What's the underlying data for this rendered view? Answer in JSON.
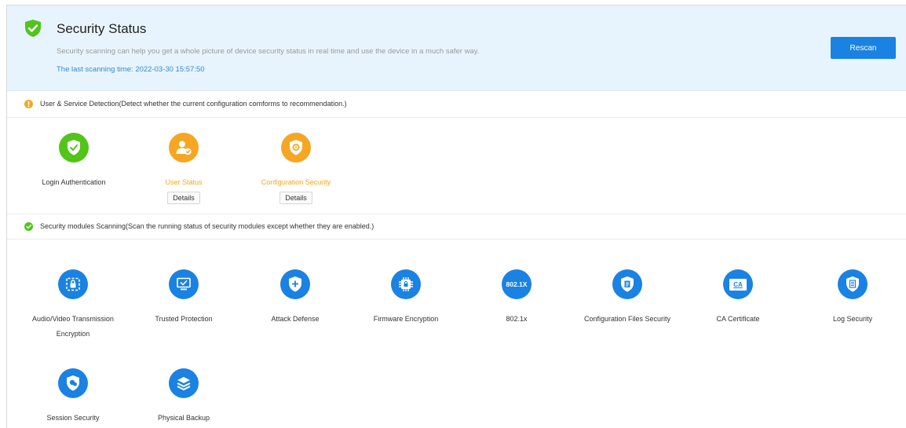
{
  "header": {
    "title": "Security Status",
    "description": "Security scanning can help you get a whole picture of device security status in real time and use the device in a much safer way.",
    "last_scan": "The last scanning time: 2022-03-30 15:57:50",
    "rescan_label": "Rescan"
  },
  "user_service": {
    "status": "warning",
    "heading": "User & Service Detection(Detect whether the current configuration comforms to recommendation.)",
    "items": [
      {
        "label": "Login Authentication",
        "state": "ok",
        "icon": "shield-check-icon"
      },
      {
        "label": "User Status",
        "state": "warning",
        "icon": "user-check-icon",
        "details_label": "Details"
      },
      {
        "label": "Configuration Security",
        "state": "warning",
        "icon": "config-shield-icon",
        "details_label": "Details"
      }
    ]
  },
  "modules": {
    "status": "ok",
    "heading": "Security modules Scanning(Scan the running status of security modules except whether they are enabled.)",
    "items": [
      {
        "label": "Audio/Video Transmission Encryption",
        "icon": "av-lock-icon"
      },
      {
        "label": "Trusted Protection",
        "icon": "monitor-check-icon"
      },
      {
        "label": "Attack Defense",
        "icon": "shield-plus-icon"
      },
      {
        "label": "Firmware Encryption",
        "icon": "chip-lock-icon"
      },
      {
        "label": "802.1x",
        "icon": "badge-802-icon",
        "badge_text": "802.1X"
      },
      {
        "label": "Configuration Files Security",
        "icon": "file-shield-icon"
      },
      {
        "label": "CA Certificate",
        "icon": "ca-certificate-icon",
        "badge_text": "CA"
      },
      {
        "label": "Log Security",
        "icon": "log-shield-icon"
      },
      {
        "label": "Session Security",
        "icon": "session-shield-icon"
      },
      {
        "label": "Physical Backup",
        "icon": "layers-icon"
      }
    ]
  },
  "colors": {
    "ok": "#52c41a",
    "warning": "#f5a623",
    "primary": "#1a82e2"
  }
}
